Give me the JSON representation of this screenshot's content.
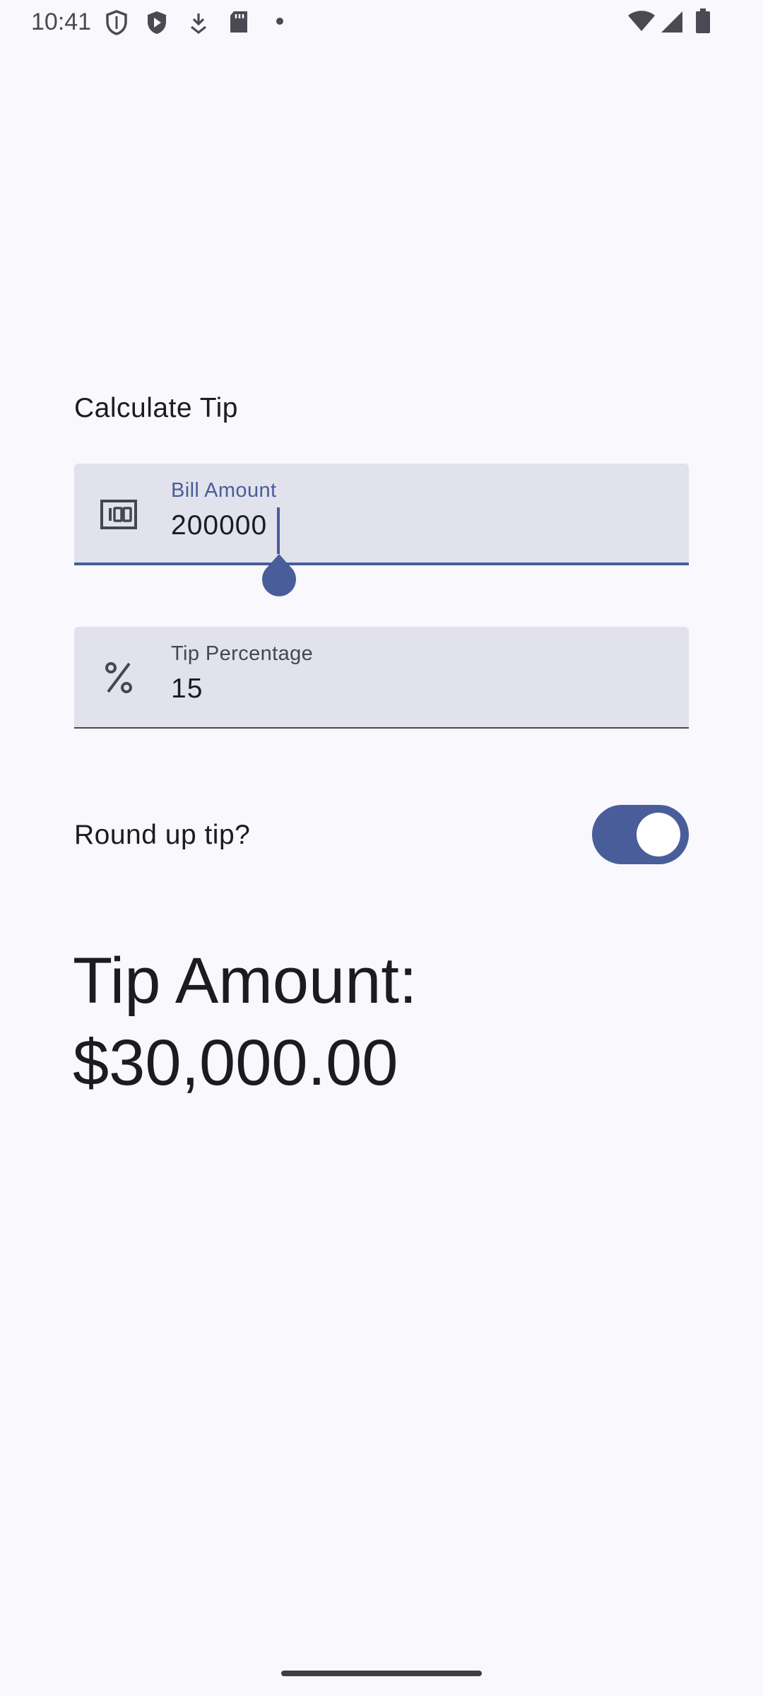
{
  "status_bar": {
    "time": "10:41",
    "icons_left": [
      "shield-outline-icon",
      "shield-play-icon",
      "download-icon",
      "sd-card-icon",
      "dot-icon"
    ],
    "icons_right": [
      "wifi-icon",
      "cellular-signal-icon",
      "battery-icon"
    ]
  },
  "screen": {
    "title": "Calculate Tip"
  },
  "bill_field": {
    "label": "Bill Amount",
    "value": "200000",
    "icon": "money-icon",
    "focused": true
  },
  "tip_field": {
    "label": "Tip Percentage",
    "value": "15",
    "icon": "percent-icon"
  },
  "round_up": {
    "label": "Round up tip?",
    "checked": true
  },
  "result": {
    "line1": "Tip Amount:",
    "line2": "$30,000.00"
  },
  "colors": {
    "background": "#f8f8fd",
    "field_background": "#e1e2ec",
    "accent": "#4a5d9b",
    "text": "#1b1b21"
  }
}
